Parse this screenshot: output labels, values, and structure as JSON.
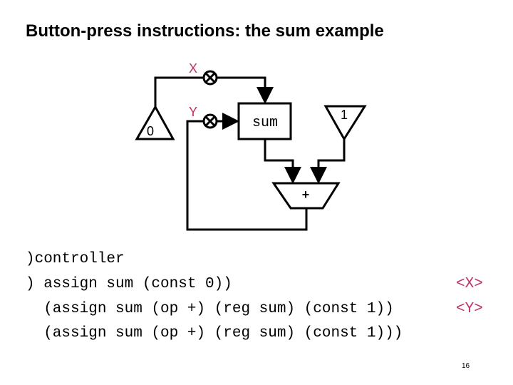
{
  "title": "Button-press instructions: the sum example",
  "diagram": {
    "const_zero_label": "0",
    "const_one_label": "1",
    "register_label": "sum",
    "adder_label": "+",
    "button_x_label": "X",
    "button_y_label": "Y"
  },
  "code": {
    "lines": [
      ")controller",
      ") assign sum (const 0))",
      "  (assign sum (op +) (reg sum) (const 1))",
      "  (assign sum (op +) (reg sum) (const 1)))"
    ],
    "tags": [
      "<X>",
      "<Y>"
    ]
  },
  "page_number": "16",
  "colors": {
    "accent": "#c0306a"
  }
}
